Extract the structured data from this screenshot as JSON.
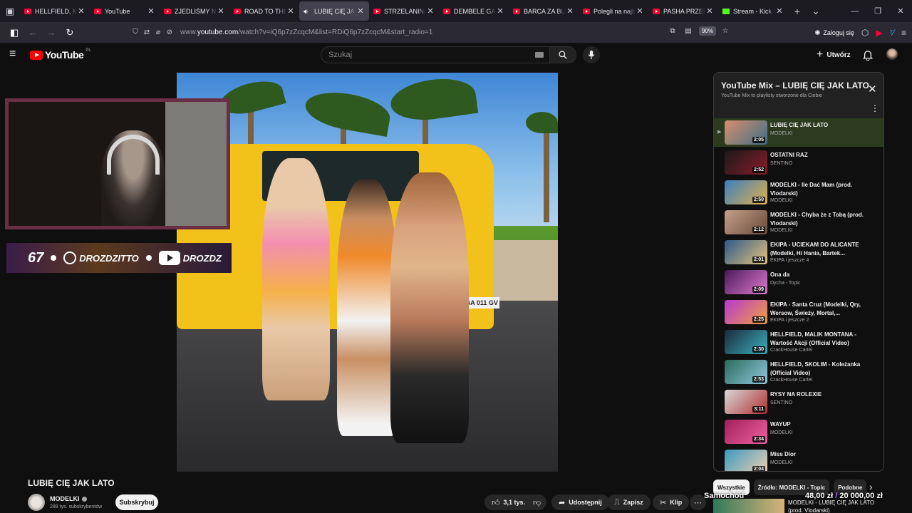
{
  "browser": {
    "tabs": [
      {
        "title": "HELLFIELD, MAC",
        "icon": "youtube",
        "active": false
      },
      {
        "title": "YouTube",
        "icon": "youtube",
        "active": false
      },
      {
        "title": "ZJEDLIŚMY NAJ",
        "icon": "youtube",
        "active": false
      },
      {
        "title": "ROAD TO THE W",
        "icon": "youtube",
        "active": false
      },
      {
        "title": "LUBIĘ CIĘ JA",
        "icon": "speaker",
        "active": true
      },
      {
        "title": "STRZELANINA W",
        "icon": "youtube",
        "active": false
      },
      {
        "title": "DEMBELE GASI Ś",
        "icon": "youtube",
        "active": false
      },
      {
        "title": "BARCA ZA BURT",
        "icon": "youtube",
        "active": false
      },
      {
        "title": "Polegli na najbar",
        "icon": "youtube",
        "active": false
      },
      {
        "title": "PASHA PRZEKAZ",
        "icon": "youtube",
        "active": false
      },
      {
        "title": "Stream - Kick Da",
        "icon": "kick",
        "active": false
      }
    ],
    "url_prefix": "www.",
    "url_host": "youtube.com",
    "url_path": "/watch?v=iQ6p7zZcqcM&list=RDiQ6p7zZcqcM&start_radio=1",
    "zoom": "90%",
    "signin_label": "Zaloguj się"
  },
  "youtube": {
    "logo_text": "YouTube",
    "country_code": "PL",
    "search_placeholder": "Szukaj",
    "create_label": "Utwórz"
  },
  "stream_overlay": {
    "viewer_count": "67",
    "social_1": "DROZDZITTO",
    "social_2": "DROZDZ"
  },
  "video": {
    "title": "LUBIĘ CIĘ JAK LATO",
    "plate": "GA 011 GV",
    "channel": "MODELKI",
    "subscribers": "288 tys. subskrybentów",
    "subscribe_label": "Subskrybuj",
    "likes": "3,1 tys.",
    "share_label": "Udostępnij",
    "save_label": "Zapisz",
    "clip_label": "Klip"
  },
  "playlist": {
    "title": "YouTube Mix – LUBIĘ CIĘ JAK LATO",
    "subtitle": "YouTube Mix to playlisty stworzone dla Ciebie",
    "items": [
      {
        "title": "LUBIĘ CIĘ JAK LATO",
        "artist": "MODELKI",
        "duration": "2:05",
        "active": true
      },
      {
        "title": "OSTATNI RAZ",
        "artist": "SENTINO",
        "duration": "2:52",
        "active": false
      },
      {
        "title": "MODELKI - Ile Dać Mam (prod. Vlodarski)",
        "artist": "MODELKI",
        "duration": "2:50",
        "active": false
      },
      {
        "title": "MODELKI - Chyba że z Tobą (prod. Vlodarski)",
        "artist": "MODELKI",
        "duration": "2:12",
        "active": false
      },
      {
        "title": "EKIPA - UCIEKAM DO ALICANTE (Modelki, Hi Hania, Bartek...",
        "artist": "EKIPA i jeszcze 4",
        "duration": "2:01",
        "active": false
      },
      {
        "title": "Ona da",
        "artist": "Dycha - Topic",
        "duration": "2:09",
        "active": false
      },
      {
        "title": "EKIPA - Santa Cruz (Modelki, Qry, Wersow, Świeży, Mortal,...",
        "artist": "EKIPA i jeszcze 2",
        "duration": "2:25",
        "active": false
      },
      {
        "title": "HELLFIELD, MALIK MONTANA - Wartość Akcji (Official Video)",
        "artist": "CrackHouse Cartel",
        "duration": "2:30",
        "active": false
      },
      {
        "title": "HELLFIELD, SKOLIM - Koleżanka (Official Video)",
        "artist": "CrackHouse Cartel",
        "duration": "2:53",
        "active": false
      },
      {
        "title": "RYSY NA ROLEXIE",
        "artist": "SENTINO",
        "duration": "3:11",
        "active": false
      },
      {
        "title": "WAYUP",
        "artist": "MODELKI",
        "duration": "2:34",
        "active": false
      },
      {
        "title": "Miss Dior",
        "artist": "MODELKI",
        "duration": "2:04",
        "active": false
      }
    ]
  },
  "chips": [
    "Wszystkie",
    "Źródło: MODELKI - Topic",
    "Podobne"
  ],
  "donation": {
    "label": "Samochód",
    "amount": "48,00 zł",
    "separator": "/",
    "goal": "20 000,00 zł"
  },
  "next_up_title": "MODELKI - LUBIĘ CIĘ JAK LATO (prod. Vlodarski)"
}
